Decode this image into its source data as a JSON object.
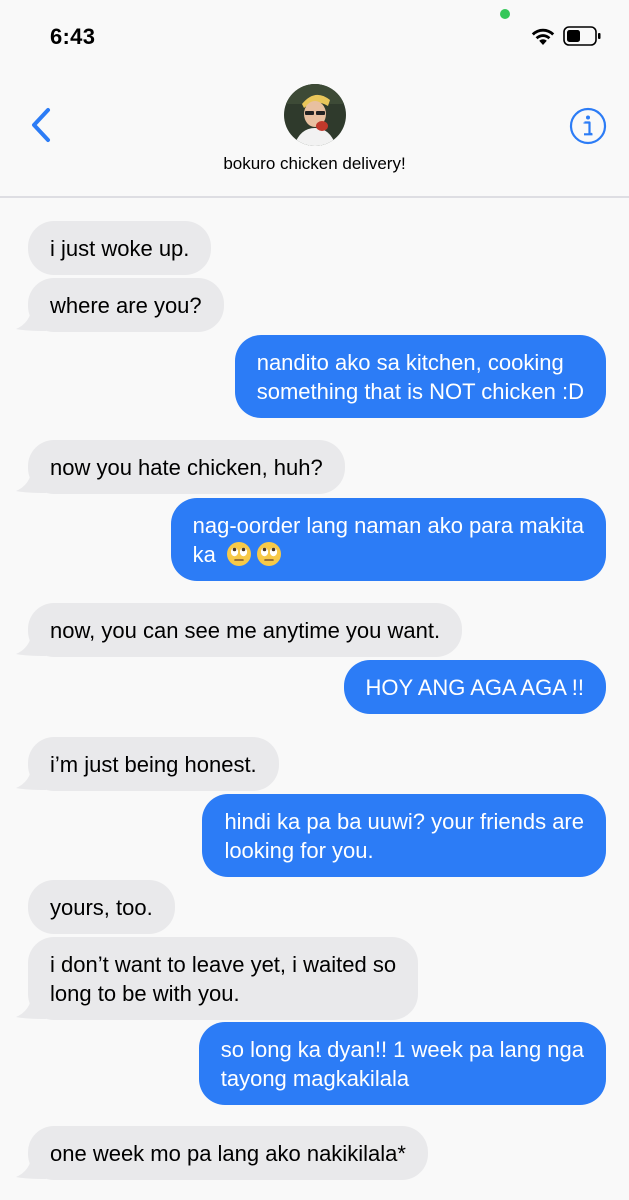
{
  "status_bar": {
    "time": "6:43"
  },
  "header": {
    "contact_name": "bokuro chicken delivery!"
  },
  "messages": [
    {
      "dir": "in",
      "text": "i just woke up."
    },
    {
      "dir": "in",
      "text": "where are you?"
    },
    {
      "dir": "out",
      "line1": "nandito ako sa kitchen, cooking",
      "line2": "something that is NOT chicken :D"
    },
    {
      "dir": "in",
      "text": "now you hate chicken, huh?"
    },
    {
      "dir": "out",
      "line1": "nag-oorder lang naman ako para makita",
      "line2": "ka",
      "emoji": "face-with-rolling-eyes"
    },
    {
      "dir": "in",
      "text": "now, you can see me anytime you want."
    },
    {
      "dir": "out",
      "text": "HOY ANG AGA AGA !!"
    },
    {
      "dir": "in",
      "text": "i’m just being honest."
    },
    {
      "dir": "out",
      "line1": "hindi ka pa ba uuwi? your friends are",
      "line2": "looking for you."
    },
    {
      "dir": "in",
      "text": "yours, too."
    },
    {
      "dir": "in",
      "line1": "i don’t want to leave yet, i waited so",
      "line2": "long to be with you."
    },
    {
      "dir": "out",
      "line1": "so long ka dyan!! 1 week pa lang nga",
      "line2": "tayong magkakilala"
    },
    {
      "dir": "in",
      "text": "one week mo pa lang ako nakikilala*"
    }
  ],
  "colors": {
    "incoming": "#e9e9eb",
    "outgoing": "#2c7cf6",
    "accent": "#2c7cf6"
  }
}
